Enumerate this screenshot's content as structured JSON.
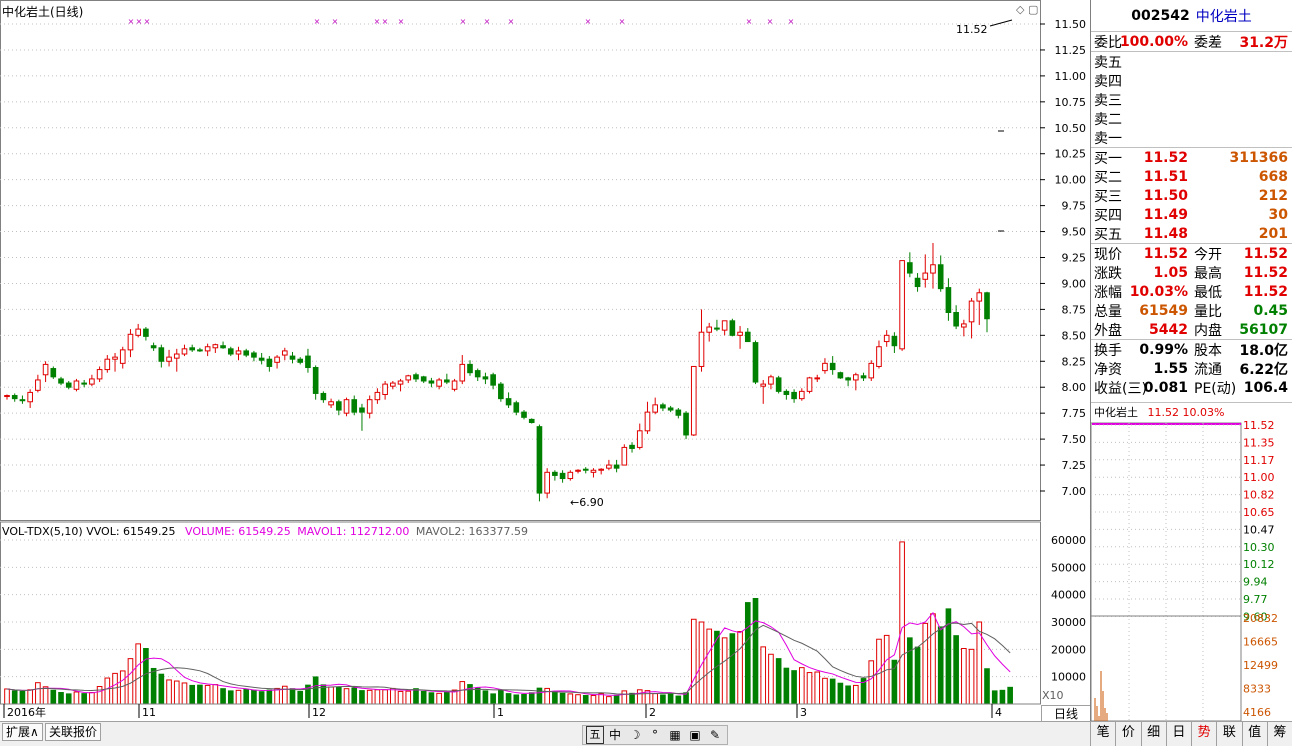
{
  "chart_title": "中化岩土(日线)",
  "price_axis": {
    "ticks": [
      "11.50",
      "11.25",
      "11.00",
      "10.75",
      "10.50",
      "10.25",
      "10.00",
      "9.75",
      "9.50",
      "9.25",
      "9.00",
      "8.75",
      "8.50",
      "8.25",
      "8.00",
      "7.75",
      "7.50",
      "7.25",
      "7.00"
    ],
    "tick_values": [
      11.5,
      11.25,
      11.0,
      10.75,
      10.5,
      10.25,
      10.0,
      9.75,
      9.5,
      9.25,
      9.0,
      8.75,
      8.5,
      8.25,
      8.0,
      7.75,
      7.5,
      7.25,
      7.0
    ]
  },
  "annotations": {
    "high_label": "11.52",
    "low_label": "6.90"
  },
  "volume_indicator": {
    "name": "VOL-TDX(5,10)",
    "vvol": "VVOL: 61549.25",
    "volume": "VOLUME: 61549.25",
    "mavol1": "MAVOL1: 112712.00",
    "mavol2": "MAVOL2: 163377.59",
    "axis_ticks": [
      "60000",
      "50000",
      "40000",
      "30000",
      "20000",
      "10000"
    ],
    "axis_values": [
      60000,
      50000,
      40000,
      30000,
      20000,
      10000
    ],
    "unit_label": "X10"
  },
  "date_axis": {
    "labels": [
      "2016年",
      "11",
      "12",
      "1",
      "2",
      "3",
      "4"
    ]
  },
  "chart_data": {
    "type": "candlestick",
    "title": "中化岩土(日线)",
    "candles": [
      [
        7.92,
        7.93,
        7.88,
        7.92
      ],
      [
        7.92,
        7.94,
        7.86,
        7.89
      ],
      [
        7.88,
        7.92,
        7.84,
        7.87
      ],
      [
        7.86,
        7.98,
        7.8,
        7.95
      ],
      [
        7.97,
        8.12,
        7.95,
        8.07
      ],
      [
        8.12,
        8.25,
        8.05,
        8.22
      ],
      [
        8.18,
        8.2,
        8.08,
        8.1
      ],
      [
        8.08,
        8.1,
        8.02,
        8.04
      ],
      [
        8.04,
        8.06,
        7.98,
        8.0
      ],
      [
        7.98,
        8.08,
        7.96,
        8.06
      ],
      [
        8.04,
        8.07,
        8.0,
        8.03
      ],
      [
        8.03,
        8.12,
        8.01,
        8.08
      ],
      [
        8.08,
        8.2,
        8.05,
        8.17
      ],
      [
        8.17,
        8.31,
        8.14,
        8.27
      ],
      [
        8.27,
        8.33,
        8.15,
        8.29
      ],
      [
        8.23,
        8.39,
        8.18,
        8.36
      ],
      [
        8.36,
        8.56,
        8.29,
        8.51
      ],
      [
        8.5,
        8.61,
        8.48,
        8.56
      ],
      [
        8.56,
        8.58,
        8.45,
        8.49
      ],
      [
        8.4,
        8.43,
        8.35,
        8.38
      ],
      [
        8.38,
        8.41,
        8.19,
        8.25
      ],
      [
        8.25,
        8.36,
        8.2,
        8.29
      ],
      [
        8.28,
        8.37,
        8.15,
        8.32
      ],
      [
        8.32,
        8.41,
        8.3,
        8.37
      ],
      [
        8.38,
        8.41,
        8.34,
        8.36
      ],
      [
        8.36,
        8.38,
        8.34,
        8.35
      ],
      [
        8.35,
        8.42,
        8.3,
        8.39
      ],
      [
        8.38,
        8.42,
        8.33,
        8.41
      ],
      [
        8.4,
        8.44,
        8.37,
        8.38
      ],
      [
        8.37,
        8.39,
        8.3,
        8.32
      ],
      [
        8.32,
        8.39,
        8.26,
        8.35
      ],
      [
        8.35,
        8.37,
        8.29,
        8.31
      ],
      [
        8.33,
        8.35,
        8.25,
        8.29
      ],
      [
        8.28,
        8.33,
        8.22,
        8.26
      ],
      [
        8.27,
        8.3,
        8.15,
        8.2
      ],
      [
        8.24,
        8.31,
        8.18,
        8.29
      ],
      [
        8.31,
        8.38,
        8.26,
        8.35
      ],
      [
        8.3,
        8.34,
        8.23,
        8.27
      ],
      [
        8.27,
        8.29,
        8.22,
        8.24
      ],
      [
        8.3,
        8.37,
        8.14,
        8.19
      ],
      [
        8.19,
        8.21,
        7.88,
        7.94
      ],
      [
        7.94,
        7.96,
        7.85,
        7.88
      ],
      [
        7.83,
        7.89,
        7.8,
        7.86
      ],
      [
        7.86,
        7.88,
        7.73,
        7.78
      ],
      [
        7.75,
        7.9,
        7.72,
        7.88
      ],
      [
        7.88,
        7.92,
        7.73,
        7.76
      ],
      [
        7.8,
        7.84,
        7.58,
        7.76
      ],
      [
        7.75,
        7.92,
        7.7,
        7.88
      ],
      [
        7.88,
        7.99,
        7.84,
        7.95
      ],
      [
        7.93,
        8.06,
        7.88,
        8.03
      ],
      [
        8.01,
        8.06,
        7.98,
        8.04
      ],
      [
        8.03,
        8.08,
        7.96,
        8.06
      ],
      [
        8.07,
        8.12,
        8.04,
        8.11
      ],
      [
        8.12,
        8.14,
        8.05,
        8.08
      ],
      [
        8.1,
        8.11,
        8.04,
        8.06
      ],
      [
        8.06,
        8.09,
        8.0,
        8.04
      ],
      [
        8.01,
        8.09,
        7.98,
        8.07
      ],
      [
        8.07,
        8.13,
        8.03,
        8.05
      ],
      [
        7.98,
        8.08,
        7.96,
        8.06
      ],
      [
        8.06,
        8.31,
        8.03,
        8.22
      ],
      [
        8.22,
        8.26,
        8.11,
        8.14
      ],
      [
        8.16,
        8.18,
        8.06,
        8.1
      ],
      [
        8.1,
        8.14,
        8.03,
        8.08
      ],
      [
        8.12,
        8.14,
        7.98,
        8.02
      ],
      [
        8.03,
        8.05,
        7.86,
        7.89
      ],
      [
        7.89,
        7.95,
        7.8,
        7.83
      ],
      [
        7.85,
        7.87,
        7.73,
        7.76
      ],
      [
        7.76,
        7.78,
        7.69,
        7.71
      ],
      [
        7.69,
        7.7,
        7.65,
        7.66
      ],
      [
        7.62,
        7.64,
        6.9,
        6.98
      ],
      [
        6.98,
        7.22,
        6.93,
        7.18
      ],
      [
        7.18,
        7.2,
        7.1,
        7.15
      ],
      [
        7.17,
        7.2,
        7.08,
        7.12
      ],
      [
        7.12,
        7.2,
        7.1,
        7.18
      ],
      [
        7.19,
        7.21,
        7.17,
        7.2
      ],
      [
        7.21,
        7.23,
        7.17,
        7.2
      ],
      [
        7.18,
        7.22,
        7.13,
        7.2
      ],
      [
        7.2,
        7.22,
        7.16,
        7.21
      ],
      [
        7.22,
        7.3,
        7.2,
        7.25
      ],
      [
        7.25,
        7.3,
        7.18,
        7.22
      ],
      [
        7.25,
        7.45,
        7.25,
        7.42
      ],
      [
        7.44,
        7.47,
        7.37,
        7.41
      ],
      [
        7.42,
        7.65,
        7.4,
        7.58
      ],
      [
        7.58,
        7.86,
        7.55,
        7.76
      ],
      [
        7.76,
        7.9,
        7.74,
        7.83
      ],
      [
        7.83,
        7.85,
        7.77,
        7.8
      ],
      [
        7.8,
        7.82,
        7.76,
        7.78
      ],
      [
        7.78,
        7.8,
        7.7,
        7.73
      ],
      [
        7.75,
        7.77,
        7.5,
        7.54
      ],
      [
        7.54,
        8.2,
        7.53,
        8.2
      ],
      [
        8.2,
        8.75,
        8.15,
        8.53
      ],
      [
        8.53,
        8.62,
        8.44,
        8.58
      ],
      [
        8.57,
        8.65,
        8.54,
        8.56
      ],
      [
        8.55,
        8.64,
        8.5,
        8.64
      ],
      [
        8.64,
        8.66,
        8.49,
        8.5
      ],
      [
        8.5,
        8.59,
        8.37,
        8.53
      ],
      [
        8.53,
        8.57,
        8.48,
        8.44
      ],
      [
        8.43,
        8.45,
        8.03,
        8.05
      ],
      [
        8.01,
        8.07,
        7.84,
        8.03
      ],
      [
        8.03,
        8.12,
        7.98,
        8.1
      ],
      [
        8.09,
        8.11,
        7.94,
        7.96
      ],
      [
        7.96,
        7.98,
        7.88,
        7.93
      ],
      [
        7.95,
        7.98,
        7.85,
        7.89
      ],
      [
        7.89,
        7.99,
        7.87,
        7.96
      ],
      [
        7.96,
        8.1,
        7.94,
        8.09
      ],
      [
        8.09,
        8.12,
        8.05,
        8.09
      ],
      [
        8.16,
        8.28,
        8.13,
        8.23
      ],
      [
        8.23,
        8.3,
        8.12,
        8.17
      ],
      [
        8.14,
        8.15,
        8.08,
        8.09
      ],
      [
        8.09,
        8.1,
        8.01,
        8.07
      ],
      [
        8.07,
        8.14,
        7.97,
        8.12
      ],
      [
        8.11,
        8.14,
        8.06,
        8.09
      ],
      [
        8.09,
        8.26,
        8.06,
        8.23
      ],
      [
        8.2,
        8.45,
        8.18,
        8.39
      ],
      [
        8.44,
        8.55,
        8.39,
        8.5
      ],
      [
        8.49,
        8.53,
        8.33,
        8.4
      ],
      [
        8.37,
        9.18,
        8.35,
        9.22
      ],
      [
        9.2,
        9.3,
        9.06,
        9.1
      ],
      [
        9.05,
        9.1,
        8.92,
        8.97
      ],
      [
        9.04,
        9.28,
        8.96,
        9.1
      ],
      [
        9.1,
        9.39,
        8.95,
        9.18
      ],
      [
        9.18,
        9.27,
        8.92,
        8.95
      ],
      [
        8.96,
        9.05,
        8.64,
        8.72
      ],
      [
        8.72,
        8.79,
        8.56,
        8.59
      ],
      [
        8.58,
        8.65,
        8.49,
        8.61
      ],
      [
        8.63,
        8.86,
        8.47,
        8.83
      ],
      [
        8.83,
        8.95,
        8.6,
        8.91
      ],
      [
        8.91,
        8.92,
        8.53,
        8.66
      ]
    ],
    "volumes": [
      5500,
      4800,
      4600,
      5200,
      7800,
      6300,
      5000,
      4200,
      3700,
      4400,
      3800,
      4200,
      6400,
      9500,
      11200,
      12100,
      16600,
      22000,
      20300,
      13000,
      10900,
      8800,
      8400,
      7700,
      6800,
      6900,
      6800,
      7100,
      5600,
      4800,
      5000,
      5300,
      5000,
      4500,
      5100,
      5700,
      6500,
      5600,
      4600,
      6900,
      9900,
      7000,
      6200,
      6200,
      5600,
      5900,
      4900,
      5000,
      5200,
      5200,
      5700,
      4600,
      4700,
      5600,
      4600,
      4100,
      3900,
      4200,
      5100,
      8200,
      7100,
      5800,
      4800,
      3700,
      5100,
      3800,
      3300,
      3500,
      4100,
      5800,
      5700,
      4600,
      3900,
      3700,
      3400,
      3100,
      3100,
      3800,
      2700,
      3200,
      4800,
      3900,
      5200,
      4900,
      3800,
      3300,
      3700,
      2900,
      4100,
      31000,
      30000,
      27400,
      26600,
      24200,
      25700,
      26500,
      37100,
      38600,
      20900,
      18200,
      16600,
      13100,
      12200,
      13300,
      11500,
      11700,
      9400,
      9100,
      7600,
      6600,
      6800,
      9300,
      15800,
      23700,
      25100,
      16000,
      59300,
      24200,
      20800,
      29500,
      33000,
      28200,
      34800,
      25000,
      20300,
      20000,
      30000,
      12900,
      4800,
      5000,
      6100
    ],
    "ma_price": null
  },
  "mini_chart": {
    "ticks": [
      "11.52",
      "11.35",
      "11.17",
      "11.00",
      "10.82",
      "10.65",
      "10.47",
      "10.30",
      "10.12",
      "9.94",
      "9.77",
      "9.60"
    ],
    "vol_ticks": [
      "20832",
      "16665",
      "12499",
      "8333",
      "4166"
    ],
    "label_name": "中化岩土",
    "label_price": "11.52",
    "label_pct": "10.03%"
  },
  "quote": {
    "code": "002542",
    "name": "中化岩土",
    "weibi_label": "委比",
    "weibi": "100.00%",
    "weicha_label": "委差",
    "weicha": "31.2万",
    "sell": [
      {
        "label": "卖五"
      },
      {
        "label": "卖四"
      },
      {
        "label": "卖三"
      },
      {
        "label": "卖二"
      },
      {
        "label": "卖一"
      }
    ],
    "buy": [
      {
        "label": "买一",
        "price": "11.52",
        "vol": "311366"
      },
      {
        "label": "买二",
        "price": "11.51",
        "vol": "668"
      },
      {
        "label": "买三",
        "price": "11.50",
        "vol": "212"
      },
      {
        "label": "买四",
        "price": "11.49",
        "vol": "30"
      },
      {
        "label": "买五",
        "price": "11.48",
        "vol": "201"
      }
    ],
    "stats": [
      {
        "l1": "现价",
        "v1": "11.52",
        "c1": "red",
        "l2": "今开",
        "v2": "11.52",
        "c2": "red"
      },
      {
        "l1": "涨跌",
        "v1": "1.05",
        "c1": "red",
        "l2": "最高",
        "v2": "11.52",
        "c2": "red"
      },
      {
        "l1": "涨幅",
        "v1": "10.03%",
        "c1": "red",
        "l2": "最低",
        "v2": "11.52",
        "c2": "red"
      },
      {
        "l1": "总量",
        "v1": "61549",
        "c1": "orange",
        "l2": "量比",
        "v2": "0.45",
        "c2": "green"
      },
      {
        "l1": "外盘",
        "v1": "5442",
        "c1": "red",
        "l2": "内盘",
        "v2": "56107",
        "c2": "green"
      }
    ],
    "stats2": [
      {
        "l1": "换手",
        "v1": "0.99%",
        "l2": "股本",
        "v2": "18.0亿"
      },
      {
        "l1": "净资",
        "v1": "1.55",
        "l2": "流通",
        "v2": "6.22亿"
      },
      {
        "l1": "收益(三)",
        "v1": "0.081",
        "l2": "PE(动)",
        "v2": "106.4"
      }
    ]
  },
  "bottom": {
    "tab1": "扩展∧",
    "tab2": "关联报价",
    "day_tab": "日线",
    "toolbar_glyphs": [
      "五",
      "中",
      "☽",
      "°",
      "▦",
      "▣",
      "✎"
    ],
    "right_tabs": [
      "笔",
      "价",
      "细",
      "日",
      "势",
      "联",
      "值",
      "筹"
    ],
    "active_right_tab": "势"
  },
  "colors": {
    "up": "#e00000",
    "down": "#008000",
    "mavol1": "#e000e0",
    "mavol2": "#606060",
    "grid": "#c0c0c0"
  }
}
